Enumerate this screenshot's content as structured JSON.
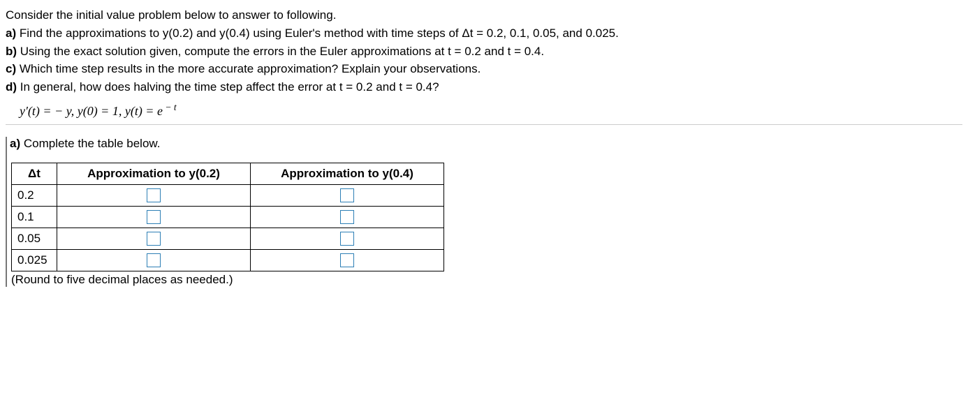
{
  "problem": {
    "intro": "Consider the initial value problem below to answer to following.",
    "a_label": "a)",
    "a_text": " Find the approximations to y(0.2) and y(0.4) using Euler's method with time steps of Δt = 0.2, 0.1, 0.05, and 0.025.",
    "b_label": "b)",
    "b_text": " Using the exact solution given, compute the errors in the Euler approximations at t = 0.2 and t = 0.4.",
    "c_label": "c)",
    "c_text": " Which time step results in the more accurate approximation? Explain your observations.",
    "d_label": "d)",
    "d_text": " In general, how does halving the time step affect the error at t = 0.2 and t = 0.4?",
    "equation_lhs": "y′(t) = − y, y(0) = 1, y(t) = ",
    "equation_e": "e",
    "equation_exp": " − t"
  },
  "part_a": {
    "label": "a)",
    "text": " Complete the table below.",
    "headers": {
      "dt": "Δt",
      "approx02": "Approximation to y(0.2)",
      "approx04": "Approximation to y(0.4)"
    },
    "rows": [
      {
        "dt": "0.2"
      },
      {
        "dt": "0.1"
      },
      {
        "dt": "0.05"
      },
      {
        "dt": "0.025"
      }
    ],
    "round_note": "(Round to five decimal places as needed.)"
  }
}
